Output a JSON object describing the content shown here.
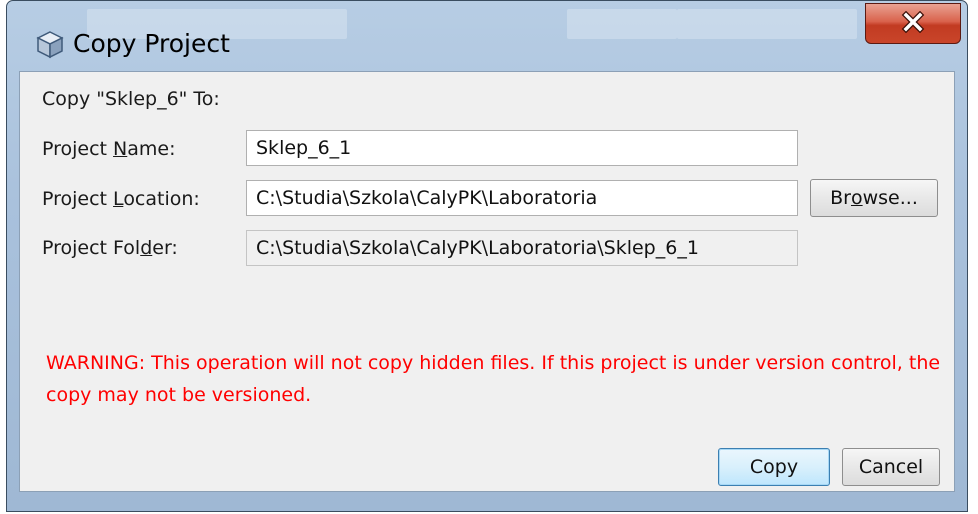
{
  "window": {
    "title": "Copy Project"
  },
  "dialog": {
    "heading": "Copy \"Sklep_6\" To:",
    "fields": {
      "project_name": {
        "label_before": "Project ",
        "label_mnemonic": "N",
        "label_after": "ame:",
        "value": "Sklep_6_1"
      },
      "project_location": {
        "label_before": "Project ",
        "label_mnemonic": "L",
        "label_after": "ocation:",
        "value": "C:\\Studia\\Szkola\\CalyPK\\Laboratoria"
      },
      "project_folder": {
        "label_before": "Project Fol",
        "label_mnemonic": "d",
        "label_after": "er:",
        "value": "C:\\Studia\\Szkola\\CalyPK\\Laboratoria\\Sklep_6_1"
      }
    },
    "browse": {
      "label_before": "Br",
      "label_mnemonic": "o",
      "label_after": "wse..."
    },
    "warning": "WARNING: This operation will not copy hidden files. If this project is under version control, the copy may not be versioned.",
    "buttons": {
      "copy": "Copy",
      "cancel": "Cancel"
    }
  },
  "colors": {
    "warning": "#ff0000",
    "close_button": "#c9452a",
    "title_bar": "#a9c1dc"
  },
  "icons": {
    "app": "cube-icon",
    "close": "close-icon"
  }
}
